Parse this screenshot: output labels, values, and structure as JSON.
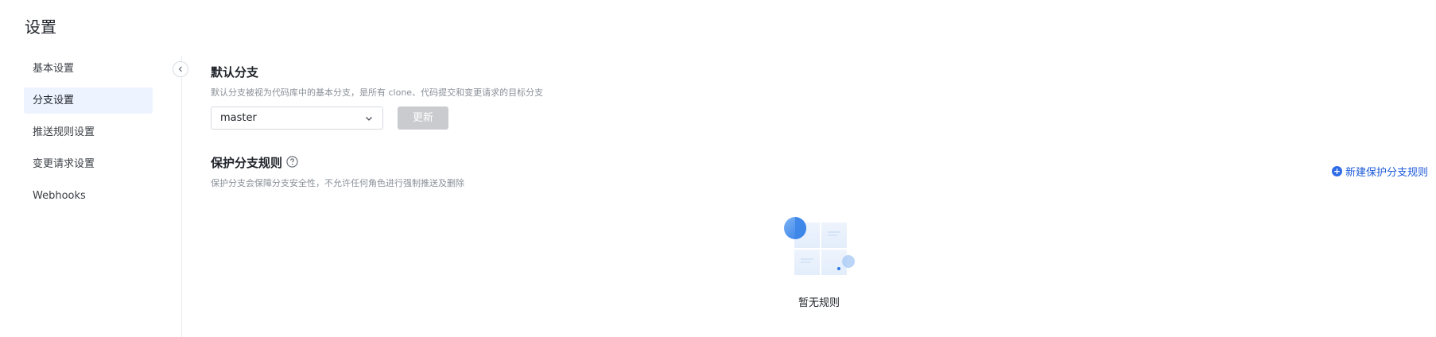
{
  "page": {
    "title": "设置"
  },
  "sidebar": {
    "items": [
      {
        "label": "基本设置",
        "active": false
      },
      {
        "label": "分支设置",
        "active": true
      },
      {
        "label": "推送规则设置",
        "active": false
      },
      {
        "label": "变更请求设置",
        "active": false
      },
      {
        "label": "Webhooks",
        "active": false
      }
    ]
  },
  "default_branch": {
    "title": "默认分支",
    "description": "默认分支被视为代码库中的基本分支，是所有 clone、代码提交和变更请求的目标分支",
    "selected": "master",
    "update_label": "更新"
  },
  "protected": {
    "title": "保护分支规则",
    "description": "保护分支会保障分支安全性，不允许任何角色进行强制推送及删除",
    "new_rule_label": "新建保护分支规则",
    "empty_text": "暂无规则"
  },
  "icons": {
    "collapse": "chevron-left-icon",
    "select": "chevron-down-icon",
    "help": "question-circle-icon",
    "new": "plus-circle-icon",
    "empty": "empty-state-illustration"
  },
  "colors": {
    "accent": "#1e5bd8",
    "active_bg": "#eef4ff",
    "disabled_btn": "#c9cbcf"
  }
}
